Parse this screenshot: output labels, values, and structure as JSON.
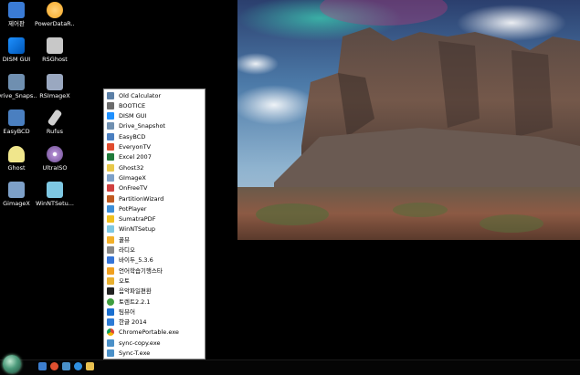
{
  "desktop": {
    "icons": [
      {
        "label": "제어판",
        "icon": "control-panel-icon",
        "color": "#3a7bd5"
      },
      {
        "label": "PowerDataR...",
        "icon": "power-data-recovery-icon",
        "color": "#f5a623"
      },
      {
        "label": "DISM GUI",
        "icon": "windows-logo-icon",
        "color": "#1e90ff"
      },
      {
        "label": "RSGhost",
        "icon": "rsghost-icon",
        "color": "#c8c8c8"
      },
      {
        "label": "Drive_Snaps...",
        "icon": "drive-snapshot-icon",
        "color": "#6f8fb0"
      },
      {
        "label": "RSImageX",
        "icon": "rsimagex-icon",
        "color": "#9aa8c0"
      },
      {
        "label": "EasyBCD",
        "icon": "easybcd-icon",
        "color": "#4a7fc0"
      },
      {
        "label": "Rufus",
        "icon": "usb-drive-icon",
        "color": "#d0d0d0"
      },
      {
        "label": "Ghost",
        "icon": "ghost-icon",
        "color": "#f0e68c"
      },
      {
        "label": "UltraISO",
        "icon": "disc-icon",
        "color": "#b08ad0"
      },
      {
        "label": "GimageX",
        "icon": "gimagex-icon",
        "color": "#7da0c8"
      },
      {
        "label": "WinNTSetu...",
        "icon": "winntsetup-icon",
        "color": "#7ec8e3"
      }
    ]
  },
  "start_menu": {
    "items": [
      {
        "label": "Old Calculator",
        "icon": "calculator-icon",
        "color": "#5b7fa6"
      },
      {
        "label": "BOOTICE",
        "icon": "bootice-icon",
        "color": "#6b6b6b"
      },
      {
        "label": "DISM GUI",
        "icon": "windows-logo-icon",
        "color": "#1e90ff"
      },
      {
        "label": "Drive_Snapshot",
        "icon": "drive-snapshot-icon",
        "color": "#6f8fb0"
      },
      {
        "label": "EasyBCD",
        "icon": "easybcd-icon",
        "color": "#4a7fc0"
      },
      {
        "label": "EveryonTV",
        "icon": "everyontv-icon",
        "color": "#e04b2d"
      },
      {
        "label": "Excel 2007",
        "icon": "excel-icon",
        "color": "#1f7a3a"
      },
      {
        "label": "Ghost32",
        "icon": "ghost-icon",
        "color": "#e8c84a"
      },
      {
        "label": "GImageX",
        "icon": "gimagex-icon",
        "color": "#7da0c8"
      },
      {
        "label": "OnFreeTV",
        "icon": "onfreetv-icon",
        "color": "#d04040"
      },
      {
        "label": "PartitionWizard",
        "icon": "partition-wizard-icon",
        "color": "#c05a20"
      },
      {
        "label": "PotPlayer",
        "icon": "play-icon",
        "color": "#3c8fd8"
      },
      {
        "label": "SumatraPDF",
        "icon": "pdf-icon",
        "color": "#f0c020"
      },
      {
        "label": "WinNTSetup",
        "icon": "winntsetup-icon",
        "color": "#7ec8e3"
      },
      {
        "label": "꿀뷰",
        "icon": "honeyview-icon",
        "color": "#f2b02a"
      },
      {
        "label": "라디오",
        "icon": "radio-icon",
        "color": "#888888"
      },
      {
        "label": "바이두_5.3.6",
        "icon": "baidu-icon",
        "color": "#3575d8"
      },
      {
        "label": "언어학습기행스타",
        "icon": "language-star-icon",
        "color": "#f0a020"
      },
      {
        "label": "오토",
        "icon": "auto-icon",
        "color": "#e8b030"
      },
      {
        "label": "음악파일편환",
        "icon": "music-file-icon",
        "color": "#222222"
      },
      {
        "label": "토렌트2.2.1",
        "icon": "torrent-icon",
        "color": "#3f9e3f"
      },
      {
        "label": "팀뷰어",
        "icon": "teamviewer-icon",
        "color": "#1a6fd0"
      },
      {
        "label": "한글 2014",
        "icon": "hangul-icon",
        "color": "#2d7bd6"
      },
      {
        "label": "ChromePortable.exe",
        "icon": "chrome-icon",
        "color": "#e0a020"
      },
      {
        "label": "sync-copy.exe",
        "icon": "sync-copy-icon",
        "color": "#4a90c8"
      },
      {
        "label": "Sync-T.exe",
        "icon": "sync-t-icon",
        "color": "#4a90c8"
      }
    ]
  },
  "taskbar": {
    "start": {
      "icon": "start-orb-icon"
    },
    "quick_launch": [
      {
        "icon": "desktop-icon",
        "color": "#3d7fd0"
      },
      {
        "icon": "media-player-icon",
        "color": "#e05030"
      },
      {
        "icon": "explorer-icon",
        "color": "#4a90c8"
      },
      {
        "icon": "internet-explorer-icon",
        "color": "#2f8fe0"
      },
      {
        "icon": "folder-icon",
        "color": "#e8c050"
      }
    ]
  }
}
